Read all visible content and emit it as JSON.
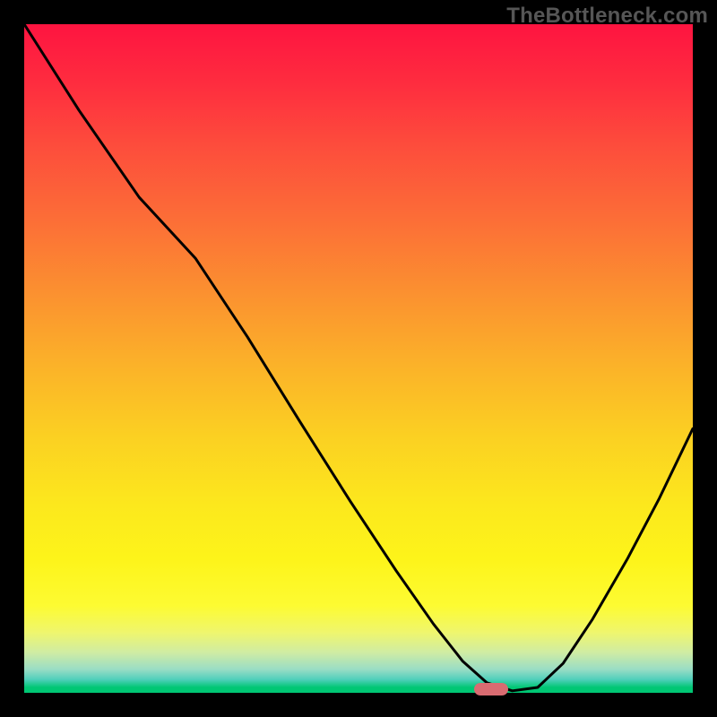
{
  "watermark": "TheBottleneck.com",
  "marker": {
    "cx_frac": 0.698,
    "cy_frac": 0.994
  },
  "chart_data": {
    "type": "line",
    "title": "",
    "xlabel": "",
    "ylabel": "",
    "xlim": [
      0,
      1
    ],
    "ylim": [
      0,
      1
    ],
    "series": [
      {
        "name": "curve",
        "x": [
          0.0,
          0.082,
          0.172,
          0.256,
          0.334,
          0.412,
          0.488,
          0.556,
          0.612,
          0.656,
          0.692,
          0.73,
          0.768,
          0.806,
          0.85,
          0.902,
          0.95,
          1.0
        ],
        "y": [
          1.0,
          0.871,
          0.741,
          0.65,
          0.532,
          0.406,
          0.286,
          0.183,
          0.103,
          0.047,
          0.015,
          0.003,
          0.008,
          0.044,
          0.11,
          0.2,
          0.291,
          0.395
        ]
      }
    ],
    "annotations": [
      {
        "type": "marker",
        "shape": "rounded-rect",
        "x": 0.698,
        "y": 0.006,
        "color": "#d96b71"
      }
    ],
    "background_gradient": {
      "direction": "vertical",
      "stops": [
        {
          "pos": 0.0,
          "color": "#fe1440"
        },
        {
          "pos": 0.5,
          "color": "#fbb229"
        },
        {
          "pos": 0.8,
          "color": "#fdf41a"
        },
        {
          "pos": 1.0,
          "color": "#00c774"
        }
      ]
    }
  }
}
